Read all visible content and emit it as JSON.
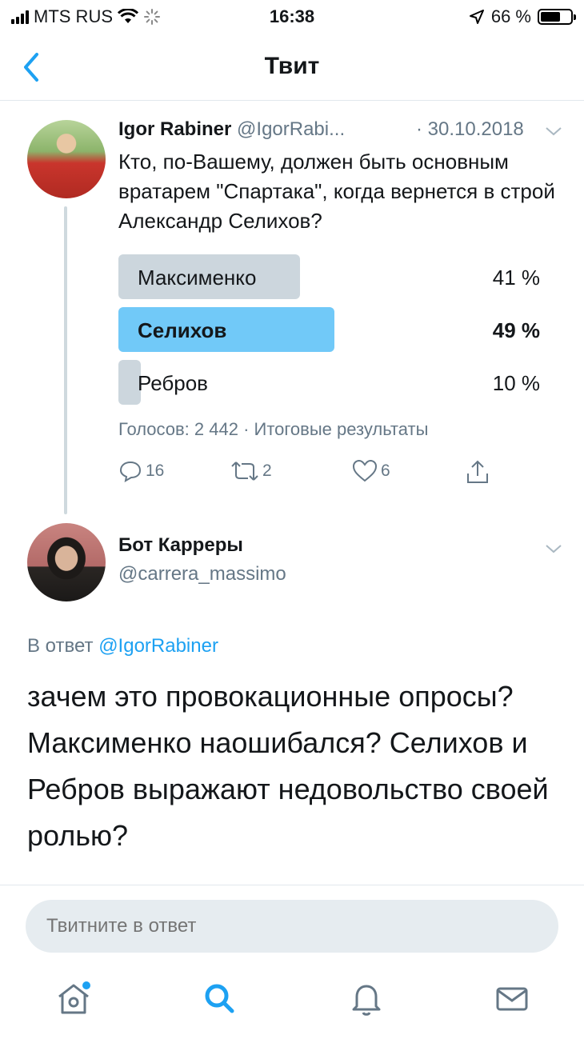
{
  "status": {
    "carrier": "MTS RUS",
    "time": "16:38",
    "battery": "66 %",
    "battery_level": 0.66
  },
  "nav": {
    "title": "Твит"
  },
  "tweet": {
    "name": "Igor Rabiner",
    "handle": "@IgorRabi...",
    "date": "· 30.10.2018",
    "text": "Кто, по-Вашему, должен быть основным вратарем \"Спартака\", когда вернется в строй Александр Селихов?",
    "poll": [
      {
        "label": "Максименко",
        "percent": "41 %",
        "value": 41,
        "winner": false
      },
      {
        "label": "Селихов",
        "percent": "49 %",
        "value": 49,
        "winner": true
      },
      {
        "label": "Ребров",
        "percent": "10 %",
        "value": 10,
        "winner": false
      }
    ],
    "poll_meta": "Голосов: 2 442 · Итоговые результаты",
    "actions": {
      "replies": "16",
      "retweets": "2",
      "likes": "6"
    }
  },
  "reply": {
    "name": "Бот Карреры",
    "handle": "@carrera_massimo",
    "reply_prefix": "В ответ",
    "reply_to": "@IgorRabiner",
    "text": "зачем это провокационные опросы?\nМаксименко наошибался? Селихов и Ребров выражают недовольство своей ролью?"
  },
  "composer": {
    "placeholder": "Твитните в ответ"
  },
  "colors": {
    "accent": "#1da1f2",
    "poll_winner": "#71c9f8",
    "poll_other": "#ccd6dd",
    "muted": "#657786"
  },
  "icons": [
    "back-chevron-icon",
    "wifi-icon",
    "location-arrow-icon",
    "chevron-down-icon",
    "reply-icon",
    "retweet-icon",
    "like-icon",
    "share-icon",
    "home-icon",
    "search-icon",
    "notifications-icon",
    "messages-icon"
  ]
}
